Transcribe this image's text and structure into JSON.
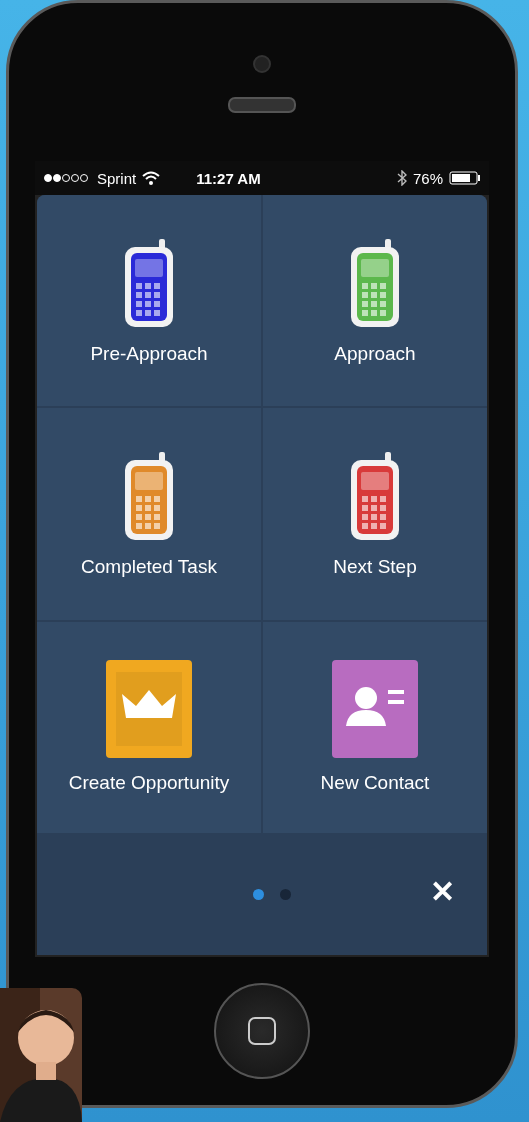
{
  "status_bar": {
    "carrier": "Sprint",
    "time": "11:27 AM",
    "battery": "76%"
  },
  "tiles": [
    {
      "label": "Pre-Approach",
      "kind": "phone",
      "color": "#2a2ad8"
    },
    {
      "label": "Approach",
      "kind": "phone",
      "color": "#5cb84c"
    },
    {
      "label": "Completed Task",
      "kind": "phone",
      "color": "#e08a2a"
    },
    {
      "label": "Next Step",
      "kind": "phone",
      "color": "#d83a3a"
    },
    {
      "label": "Create Opportunity",
      "kind": "crown",
      "color": "#f0a820"
    },
    {
      "label": "New Contact",
      "kind": "contact",
      "color": "#b86cc0"
    }
  ],
  "pager": [
    {
      "selected": true
    },
    {
      "selected": false
    }
  ],
  "close": "✕"
}
